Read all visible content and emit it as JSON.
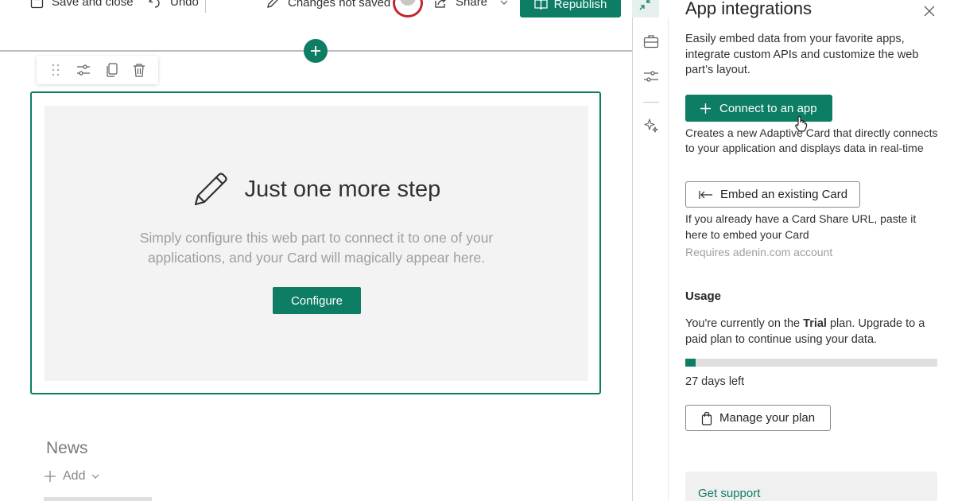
{
  "colors": {
    "accent": "#0d7d64",
    "avatar_ring": "#c4262e"
  },
  "commandbar": {
    "save_close": "Save and close",
    "undo": "Undo",
    "status": "Changes not saved",
    "share": "Share",
    "republish": "Republish",
    "icons": [
      "save-icon",
      "undo-icon",
      "chevron-down-icon",
      "more-icon",
      "pencil-icon",
      "avatar",
      "share-icon",
      "book-icon",
      "collapse-icon"
    ]
  },
  "canvas": {
    "toolbar_icons": [
      "drag-handle-icon",
      "settings-sliders-icon",
      "duplicate-icon",
      "delete-icon"
    ],
    "webpart": {
      "title": "Just one more step",
      "description_line1": "Simply configure this web part to connect it to one of your",
      "description_line2": "applications, and your Card will magically appear here.",
      "configure": "Configure"
    },
    "news": {
      "title": "News",
      "add": "Add"
    }
  },
  "rail": {
    "icons": [
      "toolbox-icon",
      "settings-sliders-icon",
      "sparkle-icon"
    ]
  },
  "panel": {
    "title": "App integrations",
    "intro": "Easily embed data from your favorite apps, integrate custom APIs and customize the web part’s layout.",
    "connect": {
      "label": "Connect to an app",
      "description": "Creates a new Adaptive Card that directly connects to your application and displays data in real-time"
    },
    "embed": {
      "label": "Embed an existing Card",
      "description": "If you already have a Card Share URL, paste it here to embed your Card",
      "requirement": "Requires adenin.com account"
    },
    "usage": {
      "title": "Usage",
      "text_before": "You're currently on the ",
      "plan": "Trial",
      "text_after": " plan. Upgrade to a paid plan to continue using your data.",
      "progress_fraction": 0.04,
      "days_left": "27 days left",
      "manage": "Manage your plan"
    },
    "support": "Get support"
  }
}
